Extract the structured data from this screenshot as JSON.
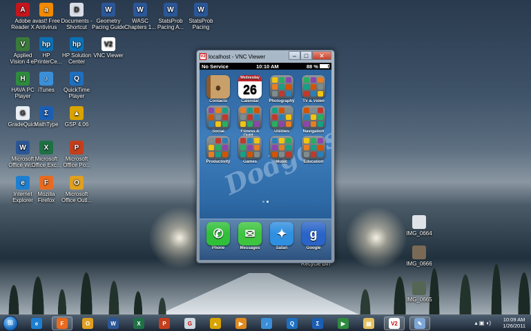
{
  "desktop": {
    "icons": [
      {
        "label": "Adobe\nReader X",
        "glyph": "A",
        "color": "#c4161c",
        "icon": "pdf-icon"
      },
      {
        "label": "avast! Free\nAntivirus",
        "glyph": "a",
        "color": "#f08a00",
        "icon": "avast-icon"
      },
      {
        "label": "Documents -\nShortcut",
        "glyph": "D",
        "color": "#d8dde6",
        "icon": "document-icon"
      },
      {
        "label": "Geometry\nPacing Guide",
        "glyph": "W",
        "color": "#2b5797",
        "icon": "word-doc-icon"
      },
      {
        "label": "WASC\nChapters 1...",
        "glyph": "W",
        "color": "#2b5797",
        "icon": "word-doc-icon"
      },
      {
        "label": "StatsProb\nPacing A...",
        "glyph": "W",
        "color": "#2b5797",
        "icon": "word-doc-icon"
      },
      {
        "label": "StatsProb\nPacing",
        "glyph": "W",
        "color": "#2b5797",
        "icon": "word-doc-icon"
      },
      {
        "label": "Applied\nVision 4 ...",
        "glyph": "V",
        "color": "#3a7a3a",
        "icon": "applied-vision-icon"
      },
      {
        "label": "HP\nePrinterCe...",
        "glyph": "hp",
        "color": "#0b70b5",
        "icon": "hp-icon"
      },
      {
        "label": "HP Solution\nCenter",
        "glyph": "hp",
        "color": "#0b70b5",
        "icon": "hp-icon"
      },
      {
        "label": "VNC Viewer",
        "glyph": "V2",
        "color": "#ffffff",
        "icon": "vnc-icon"
      },
      {
        "label": "HAVA PC\nPlayer",
        "glyph": "H",
        "color": "#2e8b3e",
        "icon": "hava-icon"
      },
      {
        "label": "iTunes",
        "glyph": "♪",
        "color": "#3b8fd9",
        "icon": "itunes-icon"
      },
      {
        "label": "QuickTime\nPlayer",
        "glyph": "Q",
        "color": "#1e6fc0",
        "icon": "quicktime-icon"
      },
      {
        "label": "GradeQuick",
        "glyph": "G",
        "color": "#e8eef4",
        "icon": "gradequick-icon"
      },
      {
        "label": "MathType",
        "glyph": "Σ",
        "color": "#1b5fb5",
        "icon": "mathtype-icon"
      },
      {
        "label": "GSP 4.06",
        "glyph": "▲",
        "color": "#d9a300",
        "icon": "gsp-icon"
      },
      {
        "label": "Microsoft\nOffice Wo...",
        "glyph": "W",
        "color": "#2b5797",
        "icon": "word-icon"
      },
      {
        "label": "Microsoft\nOffice Exc...",
        "glyph": "X",
        "color": "#1e7145",
        "icon": "excel-icon"
      },
      {
        "label": "Microsoft\nOffice Po...",
        "glyph": "P",
        "color": "#c43e1c",
        "icon": "powerpoint-icon"
      },
      {
        "label": "Internet\nExplorer",
        "glyph": "e",
        "color": "#1e7fd0",
        "icon": "ie-icon"
      },
      {
        "label": "Mozilla\nFirefox",
        "glyph": "F",
        "color": "#e86b1f",
        "icon": "firefox-icon"
      },
      {
        "label": "Microsoft\nOffice Outl...",
        "glyph": "O",
        "color": "#e0a020",
        "icon": "outlook-icon"
      },
      {
        "label": "IMG_0664",
        "glyph": "",
        "color": "#dfe3e8",
        "icon": "image-file-icon"
      },
      {
        "label": "IMG_0666",
        "glyph": "",
        "color": "#7a6a55",
        "icon": "image-file-icon"
      },
      {
        "label": "IMG_0665",
        "glyph": "",
        "color": "#556655",
        "icon": "image-file-icon"
      },
      {
        "label": "Recycle Bin",
        "glyph": "",
        "color": "transparent",
        "icon": "recycle-bin-icon"
      }
    ]
  },
  "vnc_window": {
    "title": "localhost - VNC Viewer",
    "app_icon": "V2",
    "controls": {
      "minimize": "–",
      "maximize": "□",
      "close": "✕"
    }
  },
  "phone": {
    "status": {
      "carrier": "No Service",
      "time": "10:10 AM",
      "battery": "88 %",
      "battery_level": 0.88
    },
    "calendar": {
      "weekday": "Wednesday",
      "day": "26"
    },
    "wallpaper_text": "Dodgers",
    "apps": [
      {
        "label": "Contacts",
        "kind": "contacts"
      },
      {
        "label": "Calendar",
        "kind": "calendar"
      },
      {
        "label": "Photography",
        "kind": "folder"
      },
      {
        "label": "TV & Video",
        "kind": "folder"
      },
      {
        "label": "Social",
        "kind": "folder"
      },
      {
        "label": "Fitness & Outd...",
        "kind": "folder"
      },
      {
        "label": "Utilities",
        "kind": "folder"
      },
      {
        "label": "Navigation",
        "kind": "folder"
      },
      {
        "label": "Productivity",
        "kind": "folder"
      },
      {
        "label": "Games",
        "kind": "folder"
      },
      {
        "label": "Music",
        "kind": "folder"
      },
      {
        "label": "Education",
        "kind": "folder"
      }
    ],
    "dock": [
      {
        "label": "Phone",
        "glyph": "✆",
        "color": "#2fbf38"
      },
      {
        "label": "Messages",
        "glyph": "✉",
        "color": "#3ec43e"
      },
      {
        "label": "Safari",
        "glyph": "✦",
        "color": "#2f8fe0"
      },
      {
        "label": "Google",
        "glyph": "g",
        "color": "#2a64c8"
      }
    ]
  },
  "taskbar": {
    "start_glyph": "⊞",
    "buttons": [
      {
        "name": "taskbar-ie",
        "glyph": "e",
        "color": "#1e7fd0"
      },
      {
        "name": "taskbar-firefox",
        "glyph": "F",
        "color": "#e86b1f"
      },
      {
        "name": "taskbar-outlook",
        "glyph": "O",
        "color": "#e0a020"
      },
      {
        "name": "taskbar-word",
        "glyph": "W",
        "color": "#2b5797"
      },
      {
        "name": "taskbar-excel",
        "glyph": "X",
        "color": "#1e7145"
      },
      {
        "name": "taskbar-powerpoint",
        "glyph": "P",
        "color": "#c43e1c"
      },
      {
        "name": "taskbar-gradequick",
        "glyph": "G",
        "color": "#d0d8e0"
      },
      {
        "name": "taskbar-gsp",
        "glyph": "▲",
        "color": "#d9a300"
      },
      {
        "name": "taskbar-media",
        "glyph": "▶",
        "color": "#e08a20"
      },
      {
        "name": "taskbar-itunes",
        "glyph": "♪",
        "color": "#3b8fd9"
      },
      {
        "name": "taskbar-quicktime",
        "glyph": "Q",
        "color": "#1e6fc0"
      },
      {
        "name": "taskbar-mathtype",
        "glyph": "Σ",
        "color": "#1b5fb5"
      },
      {
        "name": "taskbar-hava",
        "glyph": "▶",
        "color": "#2e8b3e"
      },
      {
        "name": "taskbar-explorer",
        "glyph": "▤",
        "color": "#e5c060"
      },
      {
        "name": "taskbar-vnc",
        "glyph": "V2",
        "color": "#ffffff"
      },
      {
        "name": "taskbar-paint",
        "glyph": "✎",
        "color": "#7ea7d8"
      }
    ],
    "tray_icons": "▴ ▣ ◖)",
    "time": "10:09 AM",
    "date": "1/26/2011"
  }
}
